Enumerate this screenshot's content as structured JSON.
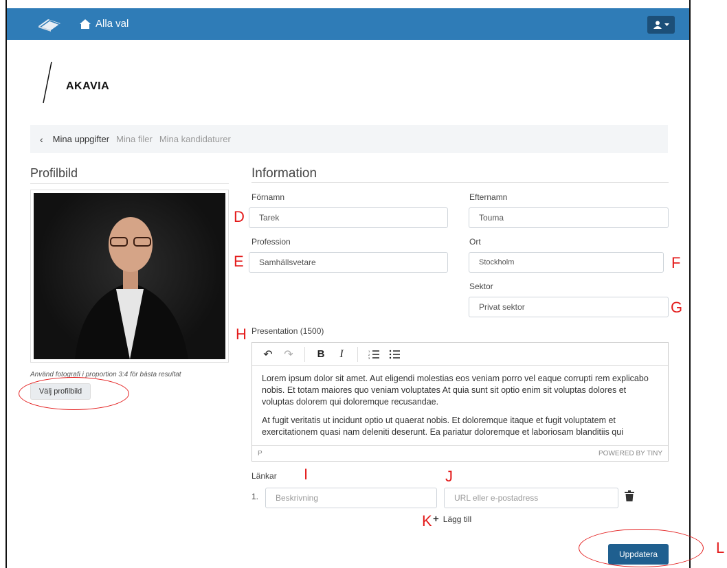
{
  "navbar": {
    "home_label": "Alla val",
    "logo_icon": "books-icon",
    "user_icon": "user-icon"
  },
  "logo": {
    "text": "AKAVIA"
  },
  "breadcrumb": {
    "back_icon": "chevron-left-icon",
    "items": [
      "Mina uppgifter",
      "Mina filer",
      "Mina kandidaturer"
    ]
  },
  "profile": {
    "title": "Profilbild",
    "hint": "Använd fotografi i proportion 3:4 för bästa resultat",
    "choose_button": "Välj profilbild"
  },
  "info": {
    "title": "Information",
    "first_name": {
      "label": "Förnamn",
      "value": "Tarek"
    },
    "last_name": {
      "label": "Efternamn",
      "value": "Touma"
    },
    "profession": {
      "label": "Profession",
      "value": "Samhällsvetare"
    },
    "city": {
      "label": "Ort",
      "value": "Stockholm"
    },
    "sector": {
      "label": "Sektor",
      "value": "Privat sektor"
    },
    "presentation": {
      "label": "Presentation (1500)",
      "paragraphs": [
        "Lorem ipsum dolor sit amet. Aut eligendi molestias eos veniam porro vel eaque corrupti rem explicabo nobis. Et totam maiores quo veniam voluptates At quia sunt sit optio enim sit voluptas dolores et voluptas dolorem qui doloremque recusandae.",
        "At fugit veritatis ut incidunt optio ut quaerat nobis. Et doloremque itaque et fugit voluptatem et exercitationem quasi nam deleniti deserunt. Ea pariatur doloremque et laboriosam blanditiis qui"
      ],
      "path": "P",
      "powered_by": "POWERED BY TINY"
    },
    "links": {
      "label": "Länkar",
      "rows": [
        {
          "number": "1.",
          "description_placeholder": "Beskrivning",
          "url_placeholder": "URL eller e-postadress"
        }
      ],
      "add_label": "Lägg till"
    },
    "update_button": "Uppdatera"
  },
  "annotations": [
    "D",
    "E",
    "F",
    "G",
    "H",
    "I",
    "J",
    "K",
    "L"
  ],
  "colors": {
    "navbar": "#2f7cb7",
    "primary_button": "#1f5f8f",
    "annotation": "#e31b1b"
  }
}
